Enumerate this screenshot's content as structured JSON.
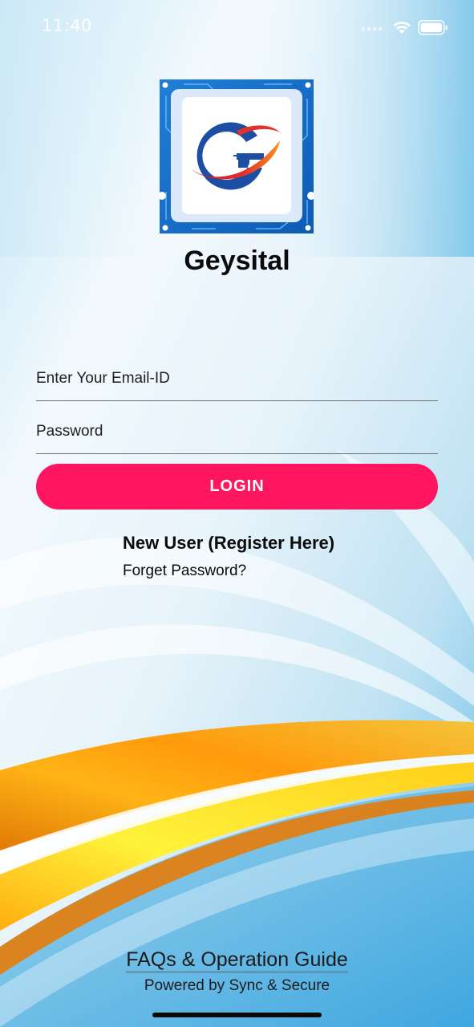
{
  "status_bar": {
    "time": "11:40",
    "icons": [
      "cellular-signal-icon",
      "wifi-icon",
      "battery-icon"
    ]
  },
  "app": {
    "logo_icon": "geysital-g-logo-icon",
    "name": "Geysital"
  },
  "login_form": {
    "email_placeholder": "Enter Your Email-ID",
    "email_value": "",
    "password_placeholder": "Password",
    "password_value": "",
    "login_label": "LOGIN"
  },
  "links": {
    "register": "New User (Register Here)",
    "forget_password": "Forget Password?"
  },
  "footer": {
    "faq": "FAQs & Operation Guide",
    "powered_by": "Powered by Sync & Secure"
  },
  "colors": {
    "accent": "#ff1560",
    "sky": "#8fd0ee",
    "swoosh_orange": "#f49a12",
    "swoosh_yellow": "#ffd21a"
  }
}
